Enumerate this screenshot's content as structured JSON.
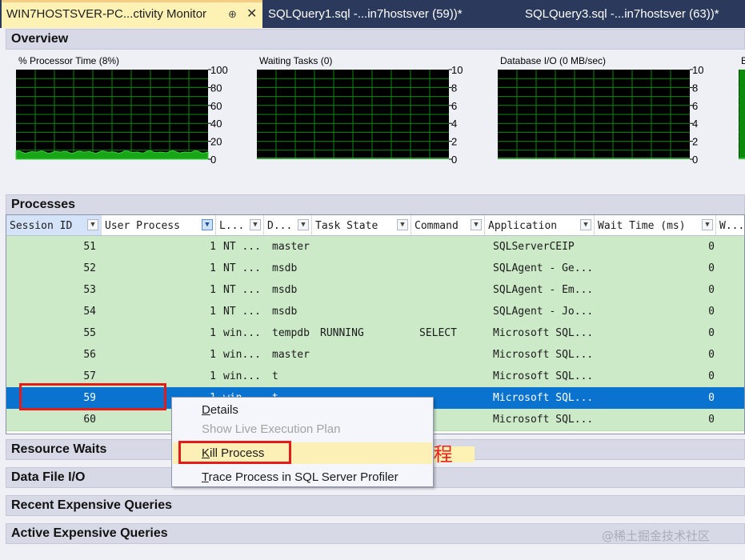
{
  "tabs": [
    {
      "label": "WIN7HOSTSVER-PC...ctivity Monitor",
      "active": true,
      "pin": "⊕",
      "close": "✕"
    },
    {
      "label": "SQLQuery1.sql -...in7hostsver (59))*",
      "active": false
    },
    {
      "label": "SQLQuery3.sql -...in7hostsver (63))*",
      "active": false
    }
  ],
  "overview": {
    "title": "Overview"
  },
  "charts": [
    {
      "title": "% Processor Time (8%)",
      "ticks": [
        "100",
        "80",
        "60",
        "40",
        "20",
        "0"
      ],
      "ylim": [
        0,
        100
      ],
      "series_level": 8
    },
    {
      "title": "Waiting Tasks (0)",
      "ticks": [
        "10",
        "8",
        "6",
        "4",
        "2",
        "0"
      ],
      "ylim": [
        0,
        10
      ],
      "series_level": 0
    },
    {
      "title": "Database I/O (0 MB/sec)",
      "ticks": [
        "10",
        "8",
        "6",
        "4",
        "2",
        "0"
      ],
      "ylim": [
        0,
        10
      ],
      "series_level": 0
    },
    {
      "title": "B",
      "ticks": [],
      "ylim": [
        0,
        10
      ],
      "series_level": 0
    }
  ],
  "processes": {
    "title": "Processes",
    "columns": [
      "Session ID",
      "User Process",
      "L...",
      "D...",
      "Task State",
      "Command",
      "Application",
      "Wait Time (ms)",
      "W..."
    ],
    "rows": [
      {
        "session": "51",
        "user": "1",
        "login": "NT ...",
        "db": "master",
        "task": "",
        "command": "",
        "app": "SQLServerCEIP",
        "wait": "0"
      },
      {
        "session": "52",
        "user": "1",
        "login": "NT ...",
        "db": "msdb",
        "task": "",
        "command": "",
        "app": "SQLAgent - Ge...",
        "wait": "0"
      },
      {
        "session": "53",
        "user": "1",
        "login": "NT ...",
        "db": "msdb",
        "task": "",
        "command": "",
        "app": "SQLAgent - Em...",
        "wait": "0"
      },
      {
        "session": "54",
        "user": "1",
        "login": "NT ...",
        "db": "msdb",
        "task": "",
        "command": "",
        "app": "SQLAgent - Jo...",
        "wait": "0"
      },
      {
        "session": "55",
        "user": "1",
        "login": "win...",
        "db": "tempdb",
        "task": "RUNNING",
        "command": "SELECT",
        "app": "Microsoft SQL...",
        "wait": "0"
      },
      {
        "session": "56",
        "user": "1",
        "login": "win...",
        "db": "master",
        "task": "",
        "command": "",
        "app": "Microsoft SQL...",
        "wait": "0"
      },
      {
        "session": "57",
        "user": "1",
        "login": "win...",
        "db": "t",
        "task": "",
        "command": "",
        "app": "Microsoft SQL...",
        "wait": "0"
      },
      {
        "session": "59",
        "user": "1",
        "login": "win...",
        "db": "t",
        "task": "",
        "command": "",
        "app": "Microsoft SQL...",
        "wait": "0",
        "selected": true
      },
      {
        "session": "60",
        "user": "",
        "login": "",
        "db": "",
        "task": "",
        "command": "",
        "app": "Microsoft SQL...",
        "wait": "0"
      }
    ]
  },
  "sections": {
    "resource_waits": "Resource Waits",
    "data_file_io": "Data File I/O",
    "recent_expensive": "Recent Expensive Queries",
    "active_expensive": "Active Expensive Queries"
  },
  "context_menu": {
    "items": [
      {
        "key": "D",
        "rest": "etails",
        "disabled": false
      },
      {
        "key": "",
        "rest": "Show Live Execution Plan",
        "disabled": true
      },
      {
        "key": "K",
        "rest": "ill Process",
        "disabled": false,
        "highlighted": true
      },
      {
        "key": "T",
        "rest": "race Process in SQL Server Profiler",
        "disabled": false
      }
    ]
  },
  "annotation": "右键-终止进程",
  "watermark": "@稀土掘金技术社区",
  "colors": {
    "chart_bg": "#000000",
    "chart_grid": "#0b8a0b",
    "chart_fill": "#18a518",
    "row_bg": "#cce9c8",
    "selected_row": "#0a73cf",
    "annotation_red": "#e31b1b"
  }
}
